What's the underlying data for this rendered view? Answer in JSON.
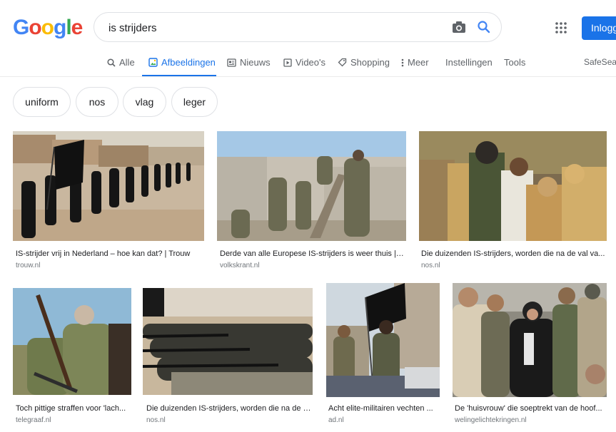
{
  "logo": {
    "letters": [
      "G",
      "o",
      "o",
      "g",
      "l",
      "e"
    ],
    "colors": [
      "#4285f4",
      "#ea4335",
      "#fbbc05",
      "#4285f4",
      "#34a853",
      "#ea4335"
    ]
  },
  "search": {
    "query": "is strijders"
  },
  "header": {
    "signin_label": "Inlogg"
  },
  "tabs": [
    {
      "label": "Alle",
      "icon": "search-icon"
    },
    {
      "label": "Afbeeldingen",
      "icon": "image-icon",
      "active": true
    },
    {
      "label": "Nieuws",
      "icon": "news-icon"
    },
    {
      "label": "Video's",
      "icon": "video-icon"
    },
    {
      "label": "Shopping",
      "icon": "tag-icon"
    },
    {
      "label": "Meer",
      "icon": "more-vert-icon"
    },
    {
      "label": "Instellingen"
    },
    {
      "label": "Tools"
    },
    {
      "label": "SafeSear"
    }
  ],
  "chips": [
    "uniform",
    "nos",
    "vlag",
    "leger"
  ],
  "results": [
    {
      "caption": "IS-strijder vrij in Nederland – hoe kan dat? | Trouw",
      "source": "trouw.nl"
    },
    {
      "caption": "Derde van alle Europese IS-strijders is weer thuis | ...",
      "source": "volkskrant.nl"
    },
    {
      "caption": "Die duizenden IS-strijders, worden die na de val va...",
      "source": "nos.nl"
    },
    {
      "caption": "Toch pittige straffen voor 'lach...",
      "source": "telegraaf.nl"
    },
    {
      "caption": "Die duizenden IS-strijders, worden die na de v...",
      "source": "nos.nl"
    },
    {
      "caption": "Acht elite-militairen vechten ...",
      "source": "ad.nl"
    },
    {
      "caption": "De 'huisvrouw' die soeptrekt van de hoof...",
      "source": "welingelichtekringen.nl"
    }
  ]
}
